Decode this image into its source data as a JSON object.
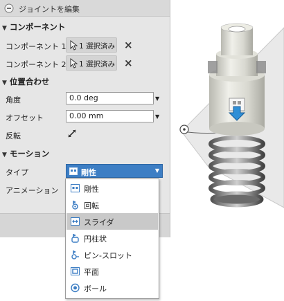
{
  "panel": {
    "title": "ジョイントを編集",
    "components": {
      "heading": "コンポーネント",
      "rows": [
        {
          "label": "コンポーネント 1",
          "button": "1 選択済み"
        },
        {
          "label": "コンポーネント 2",
          "button": "1 選択済み"
        }
      ]
    },
    "position": {
      "heading": "位置合わせ",
      "angle_label": "角度",
      "angle_value": "0.0 deg",
      "offset_label": "オフセット",
      "offset_value": "0.00 mm",
      "flip_label": "反転"
    },
    "motion": {
      "heading": "モーション",
      "type_label": "タイプ",
      "type_value": "剛性",
      "animation_label": "アニメーション"
    }
  },
  "dropdown": {
    "options": [
      "剛性",
      "回転",
      "スライダ",
      "円柱状",
      "ピン-スロット",
      "平面",
      "ボール"
    ],
    "highlighted_index": 2
  },
  "colors": {
    "accent": "#3d7ec4",
    "panel_bg": "#e6e6e6",
    "highlight": "#c9c9c9",
    "arrow_blue": "#2f8fd6"
  }
}
